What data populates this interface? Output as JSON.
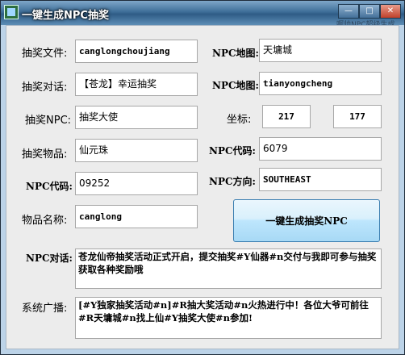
{
  "window": {
    "title": "一键生成NPC抽奖",
    "min_symbol": "—",
    "max_symbol": "□",
    "close_symbol": "✕",
    "behind_text": "啊帅NPC超级生成"
  },
  "form": {
    "lottery_file_label": "抽奖文件:",
    "lottery_file_value": "canglongchoujiang",
    "lottery_dialog_label": "抽奖对话:",
    "lottery_dialog_value": "【苍龙】幸运抽奖",
    "lottery_npc_label": "抽奖NPC:",
    "lottery_npc_value": "抽奖大使",
    "lottery_item_label": "抽奖物品:",
    "lottery_item_value": "仙元珠",
    "npc_code_left_label": "NPC代码:",
    "npc_code_left_value": "09252",
    "item_name_label": "物品名称:",
    "item_name_value": "canglong",
    "npc_map1_label": "NPC地图:",
    "npc_map1_value": "天墉城",
    "npc_map2_label": "NPC地图:",
    "npc_map2_value": "tianyongcheng",
    "coords_label": "坐标:",
    "coord_x": "217",
    "coord_y": "177",
    "npc_code_right_label": "NPC代码:",
    "npc_code_right_value": "6079",
    "npc_direction_label": "NPC方向:",
    "npc_direction_value": "SOUTHEAST",
    "generate_button": "一键生成抽奖NPC",
    "npc_dialog_label": "NPC对话:",
    "npc_dialog_value": "苍龙仙帝抽奖活动正式开启，提交抽奖#Y仙器#n交付与我即可参与抽奖获取各种奖励哦",
    "broadcast_label": "系统广播:",
    "broadcast_value": "[#Y独家抽奖活动#n]#R抽大奖活动#n火热进行中！各位大爷可前往#R天墉城#n找上仙#Y抽奖大使#n参加!"
  }
}
